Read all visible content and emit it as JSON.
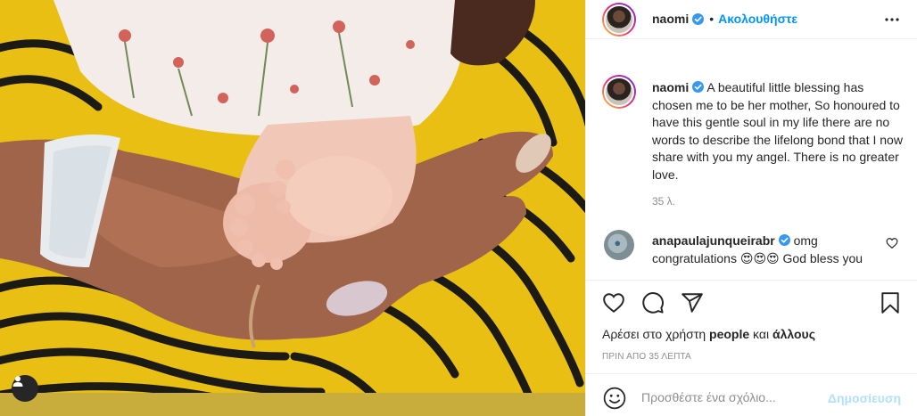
{
  "photo": {
    "alt_description_icon": "baby-feet-photo",
    "tag_button_icon": "user-tag-icon"
  },
  "header": {
    "username": "naomi",
    "verified_icon": "verified-badge-icon",
    "separator": "•",
    "follow_label": "Ακολουθήστε",
    "more_icon": "more-options-icon"
  },
  "caption": {
    "username": "naomi",
    "text": "A beautiful little blessing has chosen me to be her mother, So honoured to have this gentle soul in my life there are no words to describe the lifelong bond that I now share with you my angel. There is no greater love.",
    "time": "35 λ."
  },
  "comments": [
    {
      "username": "anapaulajunqueirabr",
      "text_before": "omg congratulations",
      "emoji": "😍😍😍",
      "text_after": "God bless you"
    }
  ],
  "actions": {
    "like_icon": "heart-icon",
    "comment_icon": "comment-icon",
    "share_icon": "share-icon",
    "save_icon": "bookmark-icon",
    "likes_prefix": "Αρέσει στο χρήστη",
    "likes_user": "people",
    "likes_middle": "και",
    "likes_others": "άλλους",
    "post_time": "ΠΡΙΝ ΑΠΟ 35 ΛΕΠΤΑ"
  },
  "add_comment": {
    "emoji_icon": "emoji-icon",
    "placeholder": "Προσθέστε ένα σχόλιο...",
    "publish_label": "Δημοσίευση"
  },
  "colors": {
    "accent": "#0095f6",
    "publish_disabled": "#b2dffc",
    "secondary_text": "#8e8e8e",
    "border": "#efefef",
    "photo_yellow": "#e9c21d"
  }
}
